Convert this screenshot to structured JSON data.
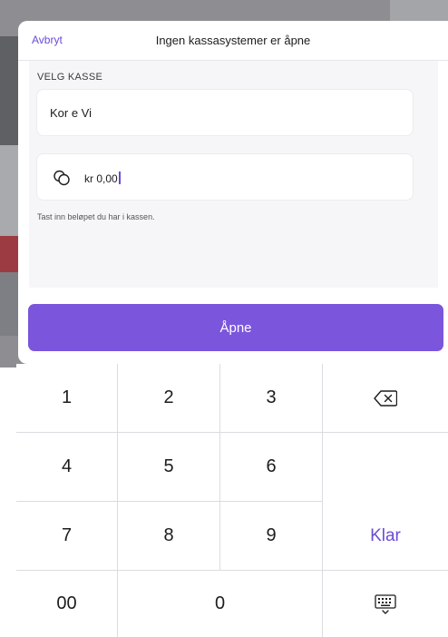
{
  "sheet": {
    "cancel_label": "Avbryt",
    "title": "Ingen kassasystemer er åpne",
    "section_label": "VELG KASSE",
    "register_value": "Kor e Vi",
    "amount_icon": "coins-icon",
    "amount_value": "kr 0,00",
    "hint": "Tast inn beløpet du har i kassen.",
    "open_label": "Åpne"
  },
  "keypad": {
    "keys": [
      "1",
      "2",
      "3",
      "4",
      "5",
      "6",
      "7",
      "8",
      "9",
      "00",
      "0"
    ],
    "done_label": "Klar",
    "backspace_icon": "backspace-icon",
    "keyboard_icon": "keyboard-dismiss-icon"
  },
  "colors": {
    "accent": "#7b55dc",
    "link": "#6b4bd6"
  }
}
